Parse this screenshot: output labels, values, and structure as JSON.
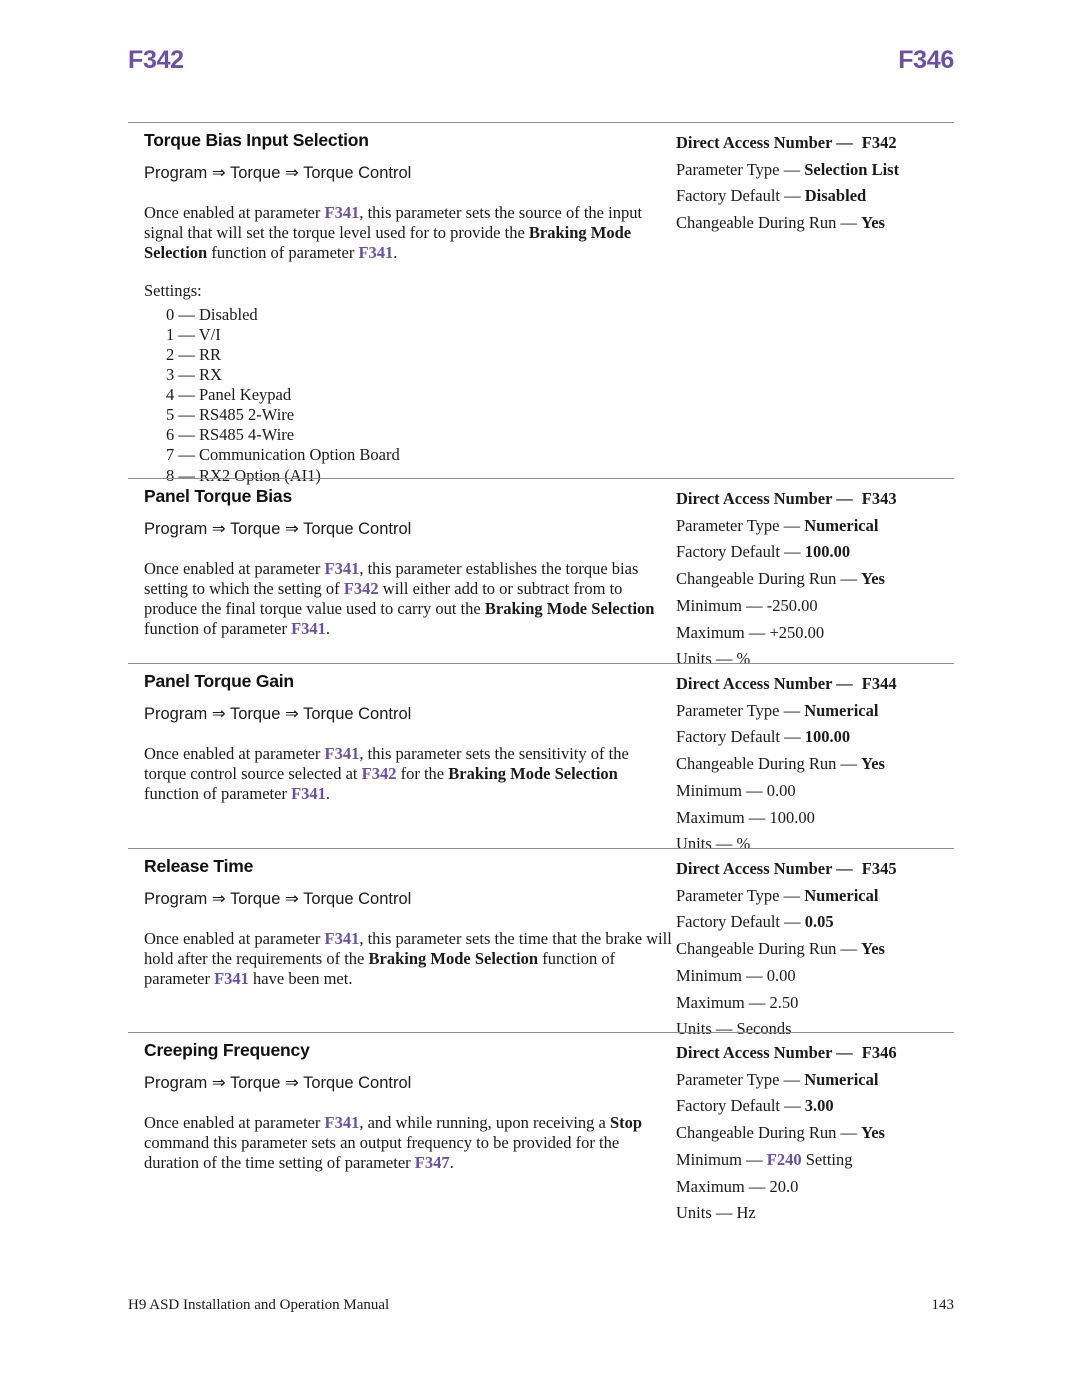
{
  "running_head": {
    "left": "F342",
    "right": "F346",
    "color": "#6a51a3"
  },
  "labels": {
    "direct_access_number": "Direct Access Number —",
    "parameter_type": "Parameter Type —",
    "factory_default": "Factory Default —",
    "changeable_during_run": "Changeable During Run —",
    "minimum": "Minimum —",
    "maximum": "Maximum —",
    "units": "Units —",
    "settings": "Settings:"
  },
  "breadcrumb": {
    "root": "Program",
    "level2": "Torque",
    "level3": "Torque Control",
    "arrow": "⇒"
  },
  "parameters": [
    {
      "title": "Torque Bias Input Selection",
      "breadcrumb": "Program ⇒ Torque ⇒ Torque Control",
      "description_runs": [
        {
          "t": "Once enabled at parameter ",
          "s": "plain"
        },
        {
          "t": "F341",
          "s": "pref"
        },
        {
          "t": ", this parameter sets the source of the input signal that will set the torque level used for to provide the ",
          "s": "plain"
        },
        {
          "t": "Braking Mode Selection",
          "s": "bold"
        },
        {
          "t": " function of parameter ",
          "s": "plain"
        },
        {
          "t": "F341",
          "s": "pref"
        },
        {
          "t": ".",
          "s": "plain"
        }
      ],
      "settings": [
        "0 — Disabled",
        "1 — V/I",
        "2 — RR",
        "3 — RX",
        "4 — Panel Keypad",
        "5 — RS485 2-Wire",
        "6 — RS485 4-Wire",
        "7 — Communication Option Board",
        "8 — RX2 Option (AI1)"
      ],
      "specs": {
        "direct_access_number": "F342",
        "parameter_type": "Selection List",
        "factory_default": "Disabled",
        "changeable_during_run": "Yes"
      }
    },
    {
      "title": "Panel Torque Bias",
      "breadcrumb": "Program ⇒ Torque ⇒ Torque Control",
      "description_runs": [
        {
          "t": "Once enabled at parameter ",
          "s": "plain"
        },
        {
          "t": "F341",
          "s": "pref"
        },
        {
          "t": ", this parameter establishes the torque bias setting to which the setting of ",
          "s": "plain"
        },
        {
          "t": "F342",
          "s": "pref"
        },
        {
          "t": " will either add to or subtract from to produce the final torque value used to carry out the ",
          "s": "plain"
        },
        {
          "t": "Braking Mode Selection",
          "s": "bold"
        },
        {
          "t": " function of parameter ",
          "s": "plain"
        },
        {
          "t": "F341",
          "s": "pref"
        },
        {
          "t": ".",
          "s": "plain"
        }
      ],
      "settings": [],
      "specs": {
        "direct_access_number": "F343",
        "parameter_type": "Numerical",
        "factory_default": "100.00",
        "changeable_during_run": "Yes",
        "minimum": "-250.00",
        "maximum": "+250.00",
        "units": "%"
      }
    },
    {
      "title": "Panel Torque Gain",
      "breadcrumb": "Program ⇒ Torque ⇒ Torque Control",
      "description_runs": [
        {
          "t": "Once enabled at parameter ",
          "s": "plain"
        },
        {
          "t": "F341",
          "s": "pref"
        },
        {
          "t": ", this parameter sets the sensitivity of the torque control source selected at ",
          "s": "plain"
        },
        {
          "t": "F342",
          "s": "pref"
        },
        {
          "t": " for the ",
          "s": "plain"
        },
        {
          "t": "Braking Mode Selection",
          "s": "bold"
        },
        {
          "t": " function of parameter ",
          "s": "plain"
        },
        {
          "t": "F341",
          "s": "pref"
        },
        {
          "t": ".",
          "s": "plain"
        }
      ],
      "settings": [],
      "specs": {
        "direct_access_number": "F344",
        "parameter_type": "Numerical",
        "factory_default": "100.00",
        "changeable_during_run": "Yes",
        "minimum": "0.00",
        "maximum": "100.00",
        "units": "%"
      }
    },
    {
      "title": "Release Time",
      "breadcrumb": "Program ⇒ Torque ⇒ Torque Control",
      "description_runs": [
        {
          "t": "Once enabled at parameter ",
          "s": "plain"
        },
        {
          "t": "F341",
          "s": "pref"
        },
        {
          "t": ", this parameter sets the time that the brake will hold after the requirements of the ",
          "s": "plain"
        },
        {
          "t": "Braking Mode Selection",
          "s": "bold"
        },
        {
          "t": " function of parameter ",
          "s": "plain"
        },
        {
          "t": "F341",
          "s": "pref"
        },
        {
          "t": " have been met.",
          "s": "plain"
        }
      ],
      "settings": [],
      "specs": {
        "direct_access_number": "F345",
        "parameter_type": "Numerical",
        "factory_default": "0.05",
        "changeable_during_run": "Yes",
        "minimum": "0.00",
        "maximum": "2.50",
        "units": "Seconds"
      }
    },
    {
      "title": "Creeping Frequency",
      "breadcrumb": "Program ⇒ Torque ⇒ Torque Control",
      "description_runs": [
        {
          "t": "Once enabled at parameter ",
          "s": "plain"
        },
        {
          "t": "F341",
          "s": "pref"
        },
        {
          "t": ", and while running, upon receiving a ",
          "s": "plain"
        },
        {
          "t": "Stop",
          "s": "bold"
        },
        {
          "t": " command this parameter sets an output frequency to be provided for the duration of the time setting of parameter ",
          "s": "plain"
        },
        {
          "t": "F347",
          "s": "pref"
        },
        {
          "t": ".",
          "s": "plain"
        }
      ],
      "settings": [],
      "specs": {
        "direct_access_number": "F346",
        "parameter_type": "Numerical",
        "factory_default": "3.00",
        "changeable_during_run": "Yes",
        "minimum_runs": [
          {
            "t": "F240",
            "s": "pref"
          },
          {
            "t": " Setting",
            "s": "plain"
          }
        ],
        "maximum": "20.0",
        "units": "Hz"
      }
    }
  ],
  "footer": {
    "manual_title": "H9 ASD Installation and Operation Manual",
    "page_number": "143"
  }
}
